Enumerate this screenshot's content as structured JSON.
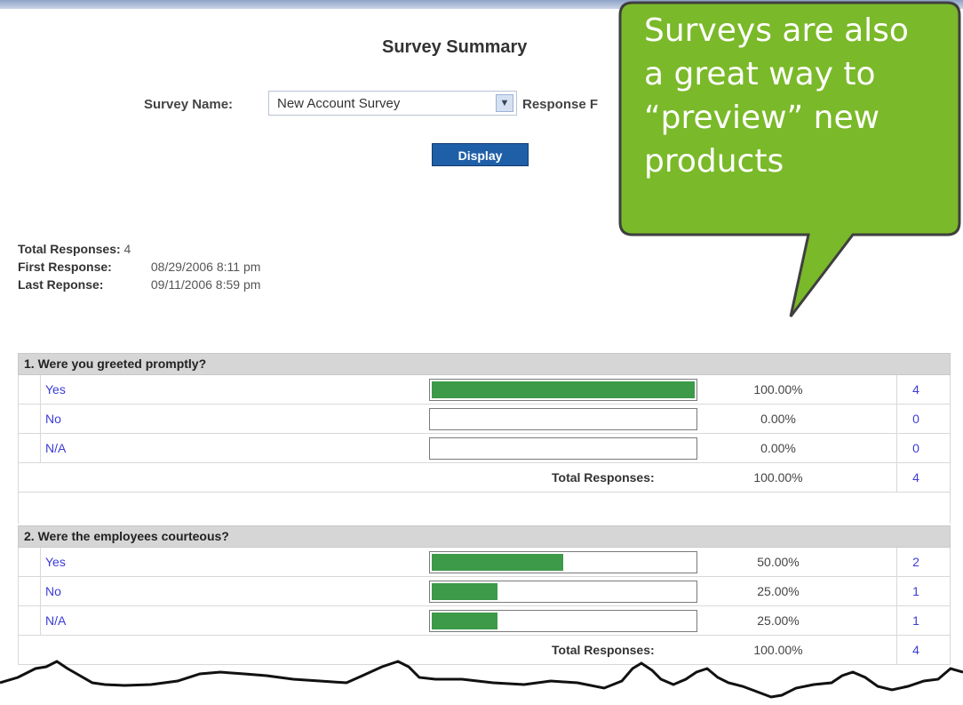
{
  "page": {
    "title": "Survey Summary",
    "survey_name_label": "Survey Name:",
    "survey_name_value": "New Account Survey",
    "response_label_partial": "Response F",
    "display_button": "Display"
  },
  "stats": {
    "total_label": "Total Responses:",
    "total_value": "4",
    "first_label": "First Response:",
    "first_value": "08/29/2006 8:11 pm",
    "last_label": "Last Reponse:",
    "last_value": "09/11/2006 8:59 pm"
  },
  "questions": [
    {
      "number": "1.",
      "title": "Were you greeted promptly?",
      "answers": [
        {
          "label": "Yes",
          "fraction": 1.0,
          "percent": "100.00%",
          "count": "4"
        },
        {
          "label": "No",
          "fraction": 0.0,
          "percent": "0.00%",
          "count": "0"
        },
        {
          "label": "N/A",
          "fraction": 0.0,
          "percent": "0.00%",
          "count": "0"
        }
      ],
      "total_label": "Total Responses:",
      "total_percent": "100.00%",
      "total_count": "4"
    },
    {
      "number": "2.",
      "title": "Were the employees courteous?",
      "answers": [
        {
          "label": "Yes",
          "fraction": 0.5,
          "percent": "50.00%",
          "count": "2"
        },
        {
          "label": "No",
          "fraction": 0.25,
          "percent": "25.00%",
          "count": "1"
        },
        {
          "label": "N/A",
          "fraction": 0.25,
          "percent": "25.00%",
          "count": "1"
        }
      ],
      "total_label": "Total Responses:",
      "total_percent": "100.00%",
      "total_count": "4"
    }
  ],
  "callout": {
    "lines": [
      "Surveys are also",
      "a great way to",
      "“preview” new",
      "products"
    ],
    "fill_color": "#7ab929",
    "border_color": "#3f3f3f"
  },
  "colors": {
    "bar_fill": "#3c9a49",
    "link_blue": "#3b3bd6",
    "button_blue": "#1f5fa8",
    "header_gray": "#d6d6d6"
  },
  "icons": {
    "dropdown": "chevron-down-icon"
  }
}
